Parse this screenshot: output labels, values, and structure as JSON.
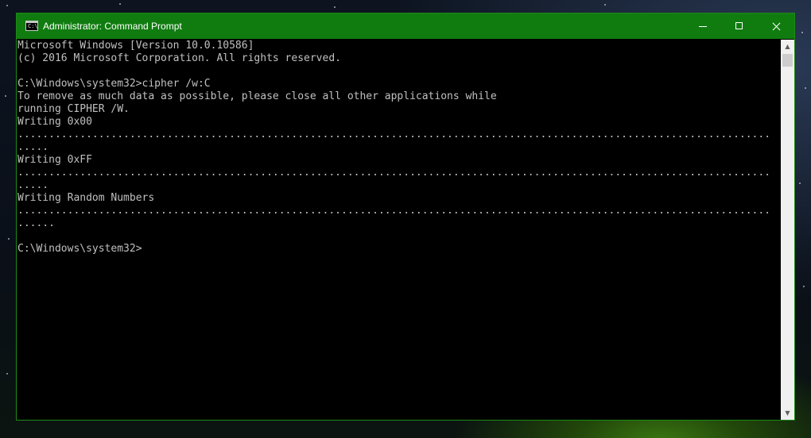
{
  "window": {
    "title": "Administrator: Command Prompt",
    "icon_text": "C:\\",
    "accent_color": "#107c10",
    "buttons": {
      "minimize": "minimize-icon",
      "maximize": "maximize-icon",
      "close": "close-icon"
    }
  },
  "console": {
    "lines": [
      "Microsoft Windows [Version 10.0.10586]",
      "(c) 2016 Microsoft Corporation. All rights reserved.",
      "",
      "C:\\Windows\\system32>cipher /w:C",
      "To remove as much data as possible, please close all other applications while",
      "running CIPHER /W.",
      "Writing 0x00",
      ".........................................................................................................................",
      ".....",
      "Writing 0xFF",
      ".........................................................................................................................",
      ".....",
      "Writing Random Numbers",
      ".........................................................................................................................",
      "......",
      "",
      "C:\\Windows\\system32>"
    ]
  },
  "scrollbar": {
    "up_icon": "scroll-up-icon",
    "down_icon": "scroll-down-icon"
  }
}
